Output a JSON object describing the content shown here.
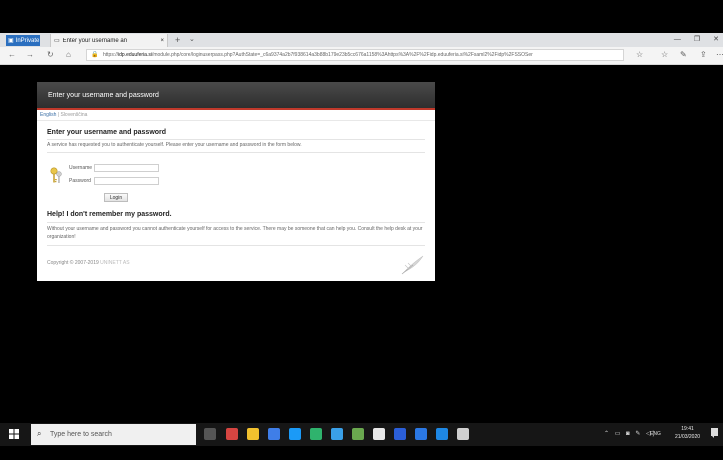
{
  "browser": {
    "inprivate_label": "InPrivate",
    "tab_title": "Enter your username an",
    "tab_close": "×",
    "new_tab": "+",
    "tab_menu": "⌄",
    "url_domain": "idp.eduuferia.si",
    "url_rest": "/module.php/core/loginuserpass.php?AuthState=_c6a9374a2b7f938614a3b88b179e23b5cc676a1158%3Ahttps%3A%2F%2Fidp.eduuferia.si%2Fsaml2%2Fidp%2FSSOSer",
    "url_prefix": "https://"
  },
  "login": {
    "header_title": "Enter your username and password",
    "lang_selected": "English",
    "lang_separator": " | ",
    "lang_other": "Slovenščina",
    "heading": "Enter your username and password",
    "description": "A service has requested you to authenticate yourself. Please enter your username and password in the form below.",
    "username_label": "Username",
    "password_label": "Password",
    "username_value": "",
    "password_value": "",
    "login_button": "Login",
    "help_heading": "Help! I don't remember my password.",
    "help_text": "Without your username and password you cannot authenticate yourself for access to the service. There may be someone that can help you. Consult the help desk at your organization!",
    "copyright_prefix": "Copyright © 2007-2019 ",
    "copyright_org": "UNINETT AS"
  },
  "taskbar": {
    "search_placeholder": "Type here to search",
    "language": "ENG",
    "time": "19:41",
    "date": "21/03/2020"
  },
  "colors": {
    "header_accent": "#c0392b",
    "inprivate": "#2b6fbf"
  }
}
